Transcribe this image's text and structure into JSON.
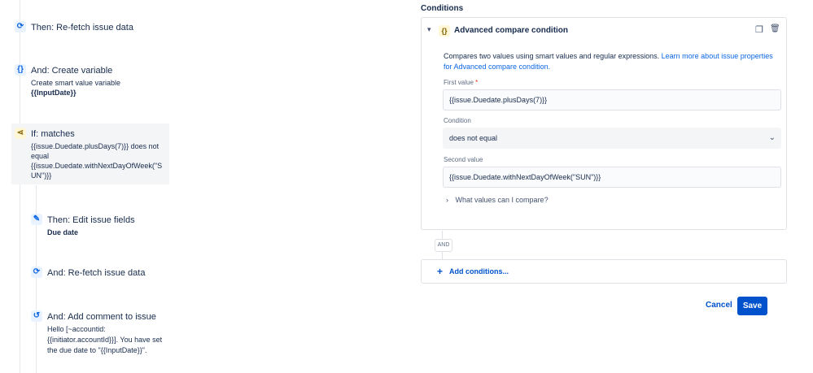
{
  "steps": [
    {
      "title": "Then: Re-fetch issue data",
      "icon": "refresh-icon"
    },
    {
      "title": "And: Create variable",
      "line1": "Create smart value variable",
      "line2": "{{InputDate}}",
      "icon": "braces-icon"
    },
    {
      "title": "If: matches",
      "line1": "{{issue.Duedate.plusDays(7)}} does not",
      "line2": "equal",
      "line3": "{{issue.Duedate.withNextDayOfWeek(\"S",
      "line4": "UN\")}}",
      "icon": "branch-icon"
    },
    {
      "title": "Then: Edit issue fields",
      "line1": "Due date",
      "icon": "pencil-icon"
    },
    {
      "title": "And: Re-fetch issue data",
      "icon": "refresh-icon"
    },
    {
      "title": "And: Add comment to issue",
      "line1": "Hello [~accountid:",
      "line2": "{{initiator.accountId}}]. You have set",
      "line3": "the due date to \"{{InputDate}}\".",
      "icon": "comment-icon"
    }
  ],
  "conditions": {
    "section_label": "Conditions",
    "card_title": "Advanced compare condition",
    "description": "Compares two values using smart values and regular expressions.",
    "learn_more": "Learn more about issue properties",
    "learn_more2": "for Advanced compare condition.",
    "first_value_label": "First value",
    "required_mark": "*",
    "first_value": "{{issue.Duedate.plusDays(7)}}",
    "condition_label": "Condition",
    "condition_value": "does not equal",
    "second_value_label": "Second value",
    "second_value": "{{issue.Duedate.withNextDayOfWeek(\"SUN\")}}",
    "help_toggle": "What values can I compare?",
    "and_label": "AND",
    "add_conditions": "Add conditions..."
  },
  "actions": {
    "cancel": "Cancel",
    "save": "Save"
  }
}
